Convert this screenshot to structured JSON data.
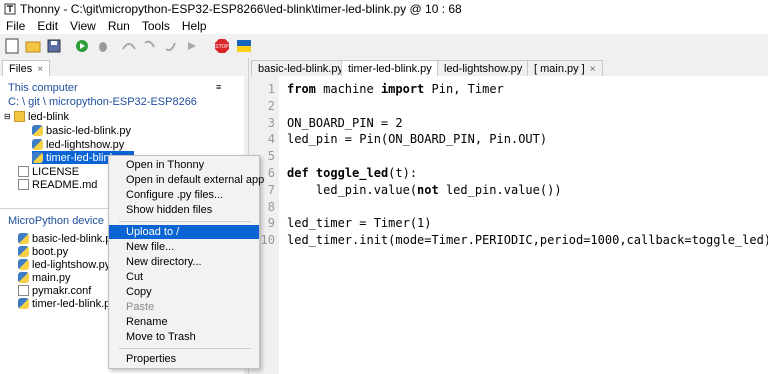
{
  "window": {
    "title": "Thonny  -  C:\\git\\micropython-ESP32-ESP8266\\led-blink\\timer-led-blink.py  @  10 : 68"
  },
  "menu": [
    "File",
    "Edit",
    "View",
    "Run",
    "Tools",
    "Help"
  ],
  "files_tab": {
    "label": "Files",
    "close": "×"
  },
  "this_computer": {
    "title": "This computer",
    "path": "C: \\ git \\ micropython-ESP32-ESP8266",
    "menu_icon": "≡",
    "tree": [
      {
        "name": "led-blink",
        "type": "folder"
      },
      {
        "name": "basic-led-blink.py",
        "type": "py"
      },
      {
        "name": "led-lightshow.py",
        "type": "py"
      },
      {
        "name": "timer-led-blink.py",
        "type": "py"
      },
      {
        "name": "LICENSE",
        "type": "file"
      },
      {
        "name": "README.md",
        "type": "file"
      }
    ]
  },
  "device": {
    "title": "MicroPython device",
    "menu_icon": "≡",
    "files": [
      "basic-led-blink.py",
      "boot.py",
      "led-lightshow.py",
      "main.py",
      "pymakr.conf",
      "timer-led-blink.py"
    ]
  },
  "editor_tabs": [
    {
      "label": "basic-led-blink.py",
      "close": "×"
    },
    {
      "label": "timer-led-blink.py",
      "close": "×"
    },
    {
      "label": "led-lightshow.py",
      "close": "×"
    },
    {
      "label": "[ main.py ]",
      "close": "×"
    }
  ],
  "code_lines": [
    {
      "no": "1",
      "parts": [
        [
          "kw",
          "from"
        ],
        [
          "t",
          " machine "
        ],
        [
          "kw",
          "import"
        ],
        [
          "t",
          " Pin, Timer"
        ]
      ]
    },
    {
      "no": "2",
      "parts": []
    },
    {
      "no": "3",
      "parts": [
        [
          "t",
          "ON_BOARD_PIN = 2"
        ]
      ]
    },
    {
      "no": "4",
      "parts": [
        [
          "t",
          "led_pin = Pin(ON_BOARD_PIN, Pin.OUT)"
        ]
      ]
    },
    {
      "no": "5",
      "parts": []
    },
    {
      "no": "6",
      "parts": [
        [
          "kw",
          "def"
        ],
        [
          "t",
          " "
        ],
        [
          "kw",
          "toggle_led"
        ],
        [
          "t",
          "(t):"
        ]
      ]
    },
    {
      "no": "7",
      "parts": [
        [
          "t",
          "    led_pin.value("
        ],
        [
          "kw",
          "not"
        ],
        [
          "t",
          " led_pin.value())"
        ]
      ]
    },
    {
      "no": "8",
      "parts": []
    },
    {
      "no": "9",
      "parts": [
        [
          "t",
          "led_timer = Timer(1)"
        ]
      ]
    },
    {
      "no": "10",
      "parts": [
        [
          "t",
          "led_timer.init(mode=Timer.PERIODIC,period=1000,callback=toggle_led)"
        ]
      ]
    }
  ],
  "context_menu": {
    "items": [
      {
        "label": "Open in Thonny",
        "state": "normal"
      },
      {
        "label": "Open in default external app",
        "state": "normal"
      },
      {
        "label": "Configure .py files...",
        "state": "normal"
      },
      {
        "label": "Show hidden files",
        "state": "normal"
      },
      {
        "sep": true
      },
      {
        "label": "Upload to /",
        "state": "highlighted"
      },
      {
        "label": "New file...",
        "state": "normal"
      },
      {
        "label": "New directory...",
        "state": "normal"
      },
      {
        "label": "Cut",
        "state": "normal"
      },
      {
        "label": "Copy",
        "state": "normal"
      },
      {
        "label": "Paste",
        "state": "disabled"
      },
      {
        "label": "Rename",
        "state": "normal"
      },
      {
        "label": "Move to Trash",
        "state": "normal"
      },
      {
        "sep": true
      },
      {
        "label": "Properties",
        "state": "normal"
      }
    ]
  },
  "toolbar": {
    "icons": [
      "new-file-icon",
      "open-folder-icon",
      "save-icon",
      "run-icon",
      "debug-icon",
      "step-over-icon",
      "step-into-icon",
      "step-out-icon",
      "resume-icon",
      "stop-icon",
      "ukraine-flag-icon"
    ]
  },
  "colors": {
    "selection": "#0a64d4",
    "section_title": "#1f4e9c",
    "stop_red": "#d9262b"
  }
}
